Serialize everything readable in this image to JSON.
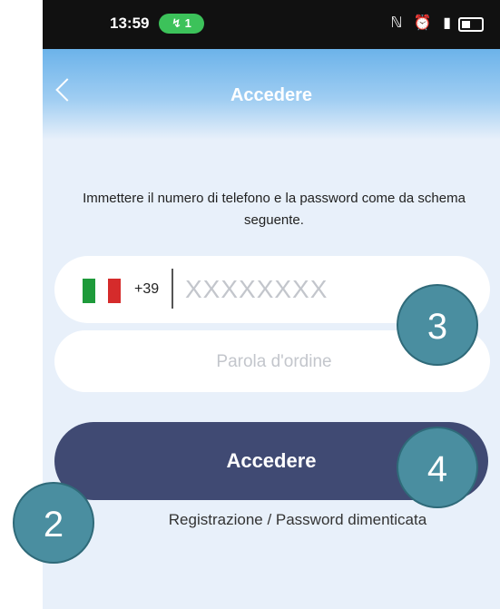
{
  "status_bar": {
    "time": "13:59",
    "notification_pill": "ℤ 1",
    "icons_text": "N ⏰ \u0001"
  },
  "header": {
    "title": "Accedere",
    "back_icon": "chevron-left-icon"
  },
  "instructions": "Immettere il numero di telefono e la password come da schema seguente.",
  "phone_field": {
    "country_code": "+39",
    "placeholder": "XXXXXXXX",
    "flag_colors": [
      "#1e9a3a",
      "#ffffff",
      "#d52b2b"
    ]
  },
  "password_field": {
    "placeholder": "Parola d'ordine"
  },
  "login_button": {
    "label": "Accedere"
  },
  "footer_link": "Registrazione / Password dimenticata",
  "annotations": {
    "badge_2": "2",
    "badge_3": "3",
    "badge_4": "4"
  },
  "colors": {
    "header_blue": "#6cb3ea",
    "button_navy": "#404a73",
    "badge_teal": "#4a8ea0",
    "background": "#e8f0fa"
  }
}
